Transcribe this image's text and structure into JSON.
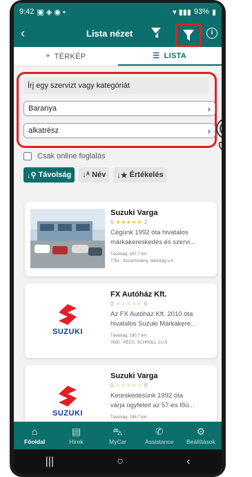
{
  "status": {
    "time": "9:42",
    "battery": "93%"
  },
  "header": {
    "title": "Lista nézet"
  },
  "tabs": [
    {
      "label": "TÉRKÉP",
      "active": false
    },
    {
      "label": "LISTA",
      "active": true
    }
  ],
  "filters": {
    "search_placeholder": "Írj egy szervizt vagy kategóriát",
    "region": "Baranya",
    "category": "alkatrész",
    "online_label": "Csak online foglalás",
    "online_checked": false
  },
  "sort": [
    {
      "label": "Távolság",
      "active": true
    },
    {
      "label": "Név",
      "active": false
    },
    {
      "label": "Értékelés",
      "active": false
    }
  ],
  "results": [
    {
      "name": "Suzuki Varga",
      "rating_value": "5",
      "stars": 5,
      "review_count": "2",
      "desc1": "Cégünk 1992 óta hivatalos",
      "desc2": "márkakereskedés és szervi...",
      "distance": "Távolság: 167.7 km",
      "address": "7761 - Kozármisleny, Vadvirág u.4"
    },
    {
      "name": "FX Autóház Kft.",
      "rating_value": "0",
      "stars": 0,
      "review_count": "0",
      "desc1": "Az FX Autóház Kft. 2010 óta",
      "desc2": "hivatalos Suzuki Márkakere...",
      "distance": "Távolság: 190.7 km",
      "address": "7630 - PÉCS, SCHROLL J.U.5"
    },
    {
      "name": "Suzuki Varga",
      "rating_value": "0",
      "stars": 0,
      "review_count": "0",
      "desc1": "Kereskedésünk 1992 óta",
      "desc2": "várja ügyfeleit az 57-es főú...",
      "distance": "Távolság: 196.7 km",
      "address": ""
    }
  ],
  "brand_text": "SUZUKI",
  "nav": [
    {
      "label": "Főoldal",
      "icon": "home-icon",
      "active": true
    },
    {
      "label": "Hírek",
      "icon": "news-icon",
      "active": false
    },
    {
      "label": "MyCar",
      "icon": "car-icon",
      "active": false
    },
    {
      "label": "Assistance",
      "icon": "phone-icon",
      "active": false
    },
    {
      "label": "Beállítások",
      "icon": "gear-icon",
      "active": false
    }
  ],
  "colors": {
    "primary": "#0c6f6b",
    "highlight": "#e31e24",
    "star": "#f0c419",
    "brand": "#103a8c"
  }
}
